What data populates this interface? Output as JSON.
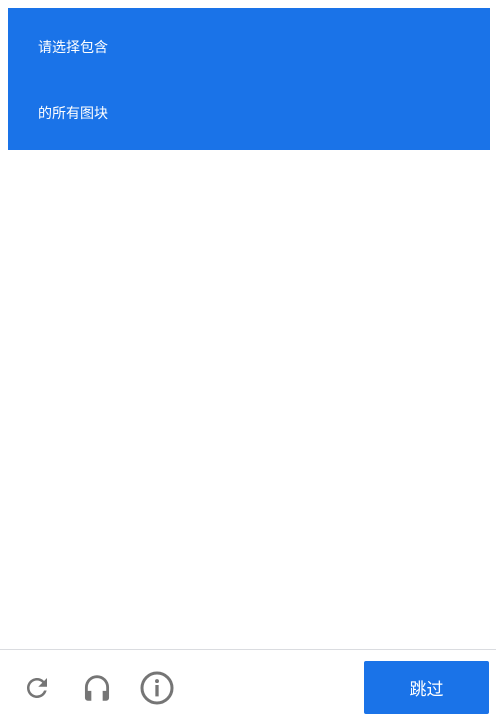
{
  "header": {
    "line1": "请选择包含",
    "line2": "的所有图块",
    "background_color": "#1a73e8"
  },
  "footer": {
    "icons": [
      "reload-icon",
      "headphones-icon",
      "info-icon"
    ],
    "icon_color": "#757575",
    "skip_label": "跳过",
    "skip_color": "#1a73e8"
  }
}
